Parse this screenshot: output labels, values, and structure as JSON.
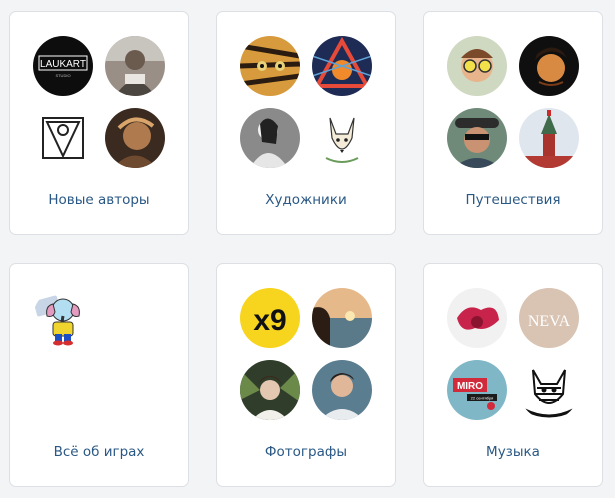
{
  "cards": [
    {
      "label": "Новые авторы",
      "avatars": [
        {
          "icon": "laukart-logo",
          "text_main": "LAUKART",
          "text_sub": "STUDIO"
        },
        {
          "icon": "person-photo"
        },
        {
          "icon": "triangle-logo"
        },
        {
          "icon": "person-photo"
        }
      ]
    },
    {
      "label": "Художники",
      "avatars": [
        {
          "icon": "tiger-art"
        },
        {
          "icon": "abstract-art"
        },
        {
          "icon": "drawing-art"
        },
        {
          "icon": "dog-sketch"
        }
      ]
    },
    {
      "label": "Путешествия",
      "avatars": [
        {
          "icon": "person-photo"
        },
        {
          "icon": "person-photo"
        },
        {
          "icon": "person-photo"
        },
        {
          "icon": "kremlin-tower-photo"
        }
      ]
    },
    {
      "label": "Всё об играх",
      "avatars": [
        {
          "icon": "elephant-mascot"
        }
      ]
    },
    {
      "label": "Фотографы",
      "avatars": [
        {
          "icon": "x9-logo",
          "text_main": "x9"
        },
        {
          "icon": "sunset-photo"
        },
        {
          "icon": "person-photo"
        },
        {
          "icon": "person-photo"
        }
      ]
    },
    {
      "label": "Музыка",
      "avatars": [
        {
          "icon": "music-photo"
        },
        {
          "icon": "neva-logo",
          "text_main": "NEVA"
        },
        {
          "icon": "miro-poster",
          "text_main": "MIRO",
          "text_sub": "22 сентября"
        },
        {
          "icon": "cat-sketch"
        }
      ]
    }
  ]
}
